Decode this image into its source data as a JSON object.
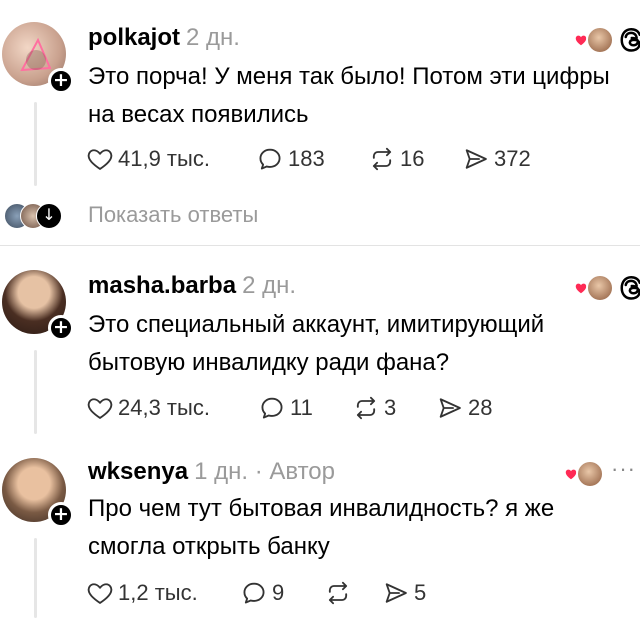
{
  "posts": [
    {
      "username": "polkajot",
      "meta": "2 дн.",
      "text": "Это порча! У меня так было! Потом эти цифры на весах появились",
      "likes": "41,9 тыс.",
      "replies": "183",
      "reposts": "16",
      "shares": "372"
    },
    {
      "username": "masha.barba",
      "meta": "2 дн.",
      "text": "Это специальный аккаунт, имитирующий бытовую инвалидку ради фана?",
      "likes": "24,3 тыс.",
      "replies": "11",
      "reposts": "3",
      "shares": "28"
    },
    {
      "username": "wksenya",
      "meta": "1 дн. · Автор",
      "text": "Про чем тут бытовая инвалидность? я же смогла открыть банку",
      "likes": "1,2 тыс.",
      "replies": "9",
      "reposts": "",
      "shares": "5"
    }
  ],
  "show_replies_label": "Показать ответы",
  "more_label": "···",
  "icons": {
    "like": "heart-icon",
    "reply": "comment-bubble-icon",
    "repost": "repost-icon",
    "share": "send-icon",
    "app": "threads-logo-icon",
    "follow": "plus-icon"
  },
  "colors": {
    "heart": "#ff2a55",
    "muted": "#9a9a9a",
    "divider": "#e3e3e3"
  }
}
